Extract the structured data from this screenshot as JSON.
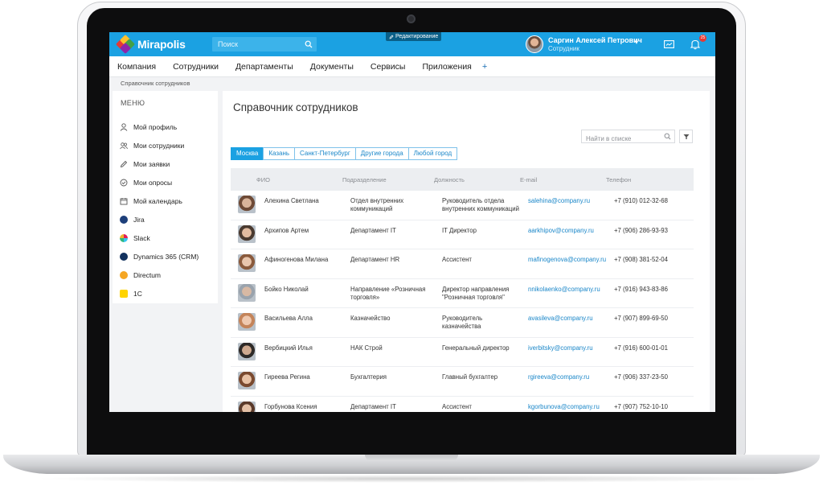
{
  "app": {
    "brand": "Mirapolis",
    "search_placeholder": "Поиск",
    "edit_mode_label": "Редактирование"
  },
  "user": {
    "name": "Саргин Алексей Петрович",
    "role": "Сотрудник",
    "notification_count": "25"
  },
  "nav": {
    "items": [
      "Компания",
      "Сотрудники",
      "Департаменты",
      "Документы",
      "Сервисы",
      "Приложения"
    ],
    "plus": "+"
  },
  "breadcrumb": "Справочник сотрудников",
  "sidebar": {
    "title": "МЕНЮ",
    "items": [
      {
        "label": "Мой профиль",
        "icon": "user-icon"
      },
      {
        "label": "Мои сотрудники",
        "icon": "users-icon"
      },
      {
        "label": "Мои заявки",
        "icon": "pencil-icon"
      },
      {
        "label": "Мои опросы",
        "icon": "check-circle-icon"
      },
      {
        "label": "Мой календарь",
        "icon": "calendar-icon"
      },
      {
        "label": "Jira",
        "icon": "jira-icon"
      },
      {
        "label": "Slack",
        "icon": "slack-icon"
      },
      {
        "label": "Dynamics 365 (CRM)",
        "icon": "dynamics-icon"
      },
      {
        "label": "Directum",
        "icon": "directum-icon"
      },
      {
        "label": "1С",
        "icon": "1c-icon"
      }
    ]
  },
  "main": {
    "title": "Справочник сотрудников",
    "search_placeholder": "Найти в списке",
    "city_tabs": [
      "Москва",
      "Казань",
      "Санкт-Петербург",
      "Другие города",
      "Любой город"
    ],
    "active_tab": "Москва",
    "columns": [
      "ФИО",
      "Подразделение",
      "Должность",
      "E-mail",
      "Телефон"
    ],
    "rows": [
      {
        "name": "Алехина Светлана",
        "dept": "Отдел внутренних коммуникаций",
        "position": "Руководитель отдела внутренних коммуникаций",
        "email": "salehina@company.ru",
        "phone": "+7 (910) 012-32-68"
      },
      {
        "name": "Архипов Артем",
        "dept": "Департамент IT",
        "position": "IT Директор",
        "email": "aarkhipov@company.ru",
        "phone": "+7 (906) 286-93-93"
      },
      {
        "name": "Афиногенова Милана",
        "dept": "Департамент HR",
        "position": "Ассистент",
        "email": "mafinogenova@company.ru",
        "phone": "+7 (908) 381-52-04"
      },
      {
        "name": "Бойко Николай",
        "dept": "Направление «Розничная торговля»",
        "position": "Директор направления \"Розничная торговля\"",
        "email": "nnikolaenko@company.ru",
        "phone": "+7 (916) 943-83-86"
      },
      {
        "name": "Васильева Алла",
        "dept": "Казначейство",
        "position": "Руководитель казначейства",
        "email": "avasileva@company.ru",
        "phone": "+7 (907) 899-69-50"
      },
      {
        "name": "Вербицкий Илья",
        "dept": "НАК Строй",
        "position": "Генеральный директор",
        "email": "iverbitsky@company.ru",
        "phone": "+7 (916) 600-01-01"
      },
      {
        "name": "Гиреева Регина",
        "dept": "Бухгалтерия",
        "position": "Главный бухгалтер",
        "email": "rgireeva@company.ru",
        "phone": "+7 (906) 337-23-50"
      },
      {
        "name": "Горбунова Ксения",
        "dept": "Департамент IT",
        "position": "Ассистент",
        "email": "kgorbunova@company.ru",
        "phone": "+7 (907) 752-10-10"
      }
    ]
  },
  "colors": {
    "accent": "#1ba1e2",
    "link": "#1b87c9",
    "badge": "#e53935"
  }
}
